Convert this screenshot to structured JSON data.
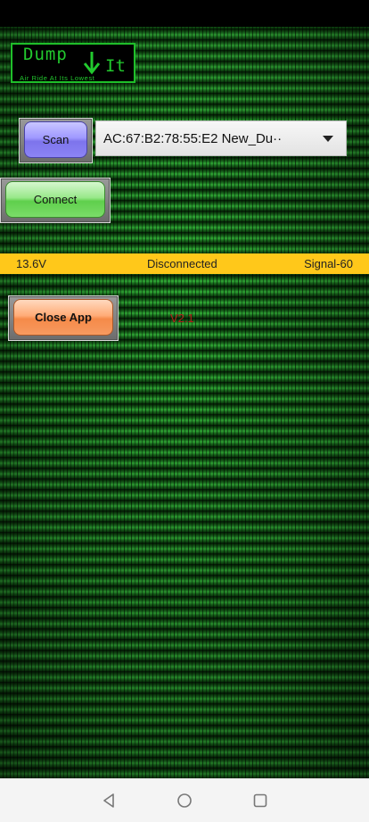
{
  "app": {
    "logo": {
      "word1": "Dump",
      "word2": "It",
      "tagline": "Air Ride At Its Lowest"
    },
    "scan_label": "Scan",
    "connect_label": "Connect",
    "close_label": "Close App",
    "device_select": {
      "selected": "AC:67:B2:78:55:E2 New_Du··"
    },
    "status": {
      "voltage": "13.6V",
      "connection": "Disconnected",
      "signal": "Signal-60"
    },
    "version": "V2.1"
  },
  "colors": {
    "accent_green": "#22c92e",
    "status_strip": "#ffc81a",
    "version_text": "#b0201a",
    "scan_button": "#9f98ff",
    "connect_button": "#5fcf4c",
    "close_button": "#f58a49"
  },
  "icons": {
    "logo_arrow": "arrow-down-icon",
    "dropdown": "caret-down-icon",
    "nav_back": "triangle-back-icon",
    "nav_home": "circle-home-icon",
    "nav_recents": "square-recents-icon"
  }
}
